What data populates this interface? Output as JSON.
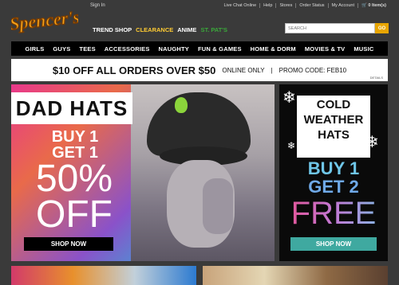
{
  "header": {
    "logo_text": "Spencer's",
    "sign_in": "Sign In",
    "util_links": [
      "Live Chat Online",
      "Help",
      "Stores",
      "Order Status",
      "My Account",
      "0 Item(s)"
    ],
    "main_nav": [
      "TREND SHOP",
      "CLEARANCE",
      "ANIME",
      "ST. PAT'S"
    ],
    "search_placeholder": "SEARCH",
    "go_label": "GO"
  },
  "categories": [
    "GIRLS",
    "GUYS",
    "TEES",
    "ACCESSORIES",
    "NAUGHTY",
    "FUN & GAMES",
    "HOME & DORM",
    "MOVIES & TV",
    "MUSIC"
  ],
  "promo": {
    "headline": "$10 OFF ALL ORDERS OVER $50",
    "online_only": "ONLINE ONLY",
    "code": "PROMO CODE: FEB10",
    "details": "DETAILS"
  },
  "hero_left": {
    "title": "DAD HATS",
    "line1": "BUY 1",
    "line2": "GET 1",
    "percent": "50%",
    "off": "OFF",
    "cta": "SHOP NOW"
  },
  "hero_right": {
    "title_lines": [
      "COLD",
      "WEATHER",
      "HATS"
    ],
    "line1": "BUY 1",
    "line2": "GET 2",
    "free": "FREE",
    "cta": "SHOP NOW"
  },
  "colors": {
    "accent_orange": "#e8a500",
    "clearance_yellow": "#ffcc33",
    "stpats_green": "#3aa83a",
    "shop_teal": "#3fa9a0"
  }
}
